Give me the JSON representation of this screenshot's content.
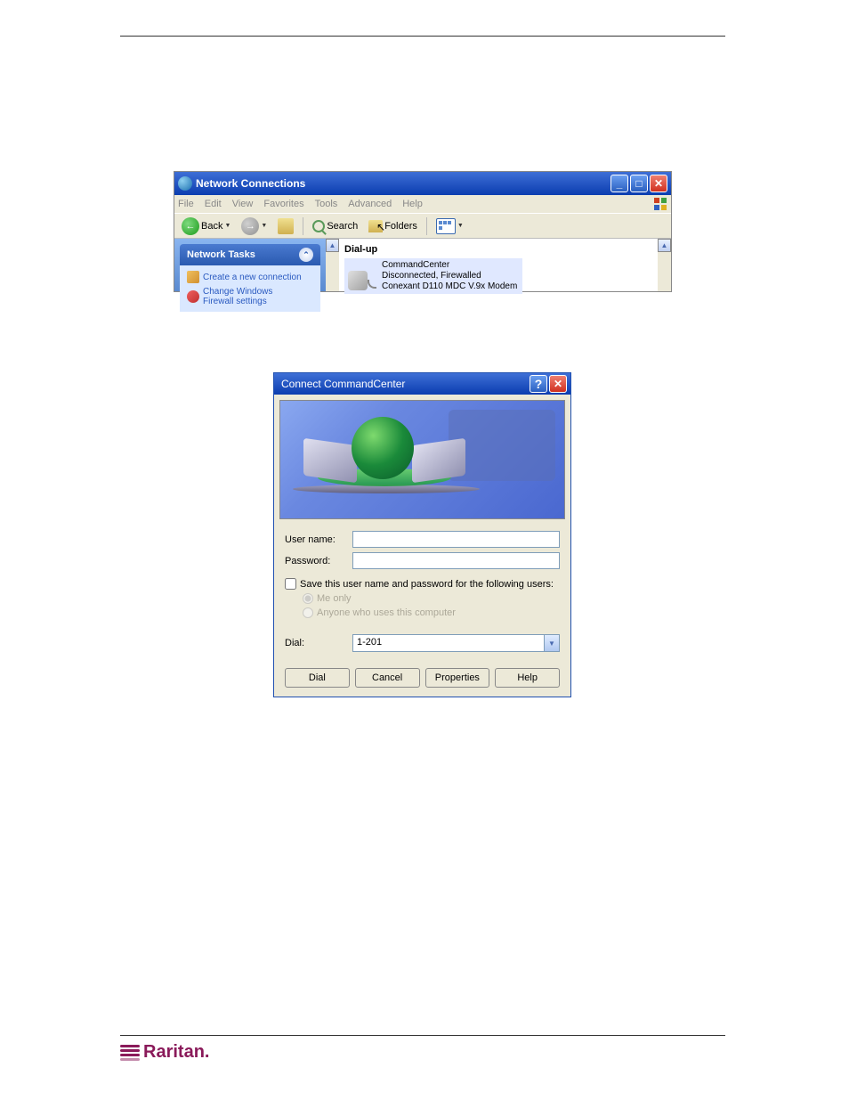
{
  "explorer_window": {
    "title": "Network Connections",
    "menu": [
      "File",
      "Edit",
      "View",
      "Favorites",
      "Tools",
      "Advanced",
      "Help"
    ],
    "toolbar": {
      "back": "Back",
      "search": "Search",
      "folders": "Folders"
    },
    "task_pane": {
      "header": "Network Tasks",
      "item_create": "Create a new connection",
      "item_firewall_l1": "Change Windows",
      "item_firewall_l2": "Firewall settings"
    },
    "content": {
      "heading": "Dial-up",
      "conn_name": "CommandCenter",
      "conn_status": "Disconnected, Firewalled",
      "conn_device": "Conexant D110 MDC V.9x Modem"
    }
  },
  "dialog": {
    "title": "Connect CommandCenter",
    "username_label": "User name:",
    "password_label": "Password:",
    "save_checkbox": "Save this user name and password for the following users:",
    "radio_me": "Me only",
    "radio_anyone": "Anyone who uses this computer",
    "dial_label": "Dial:",
    "dial_value": "1-201",
    "buttons": {
      "dial": "Dial",
      "cancel": "Cancel",
      "properties": "Properties",
      "help": "Help"
    }
  },
  "logo_text": "Raritan."
}
